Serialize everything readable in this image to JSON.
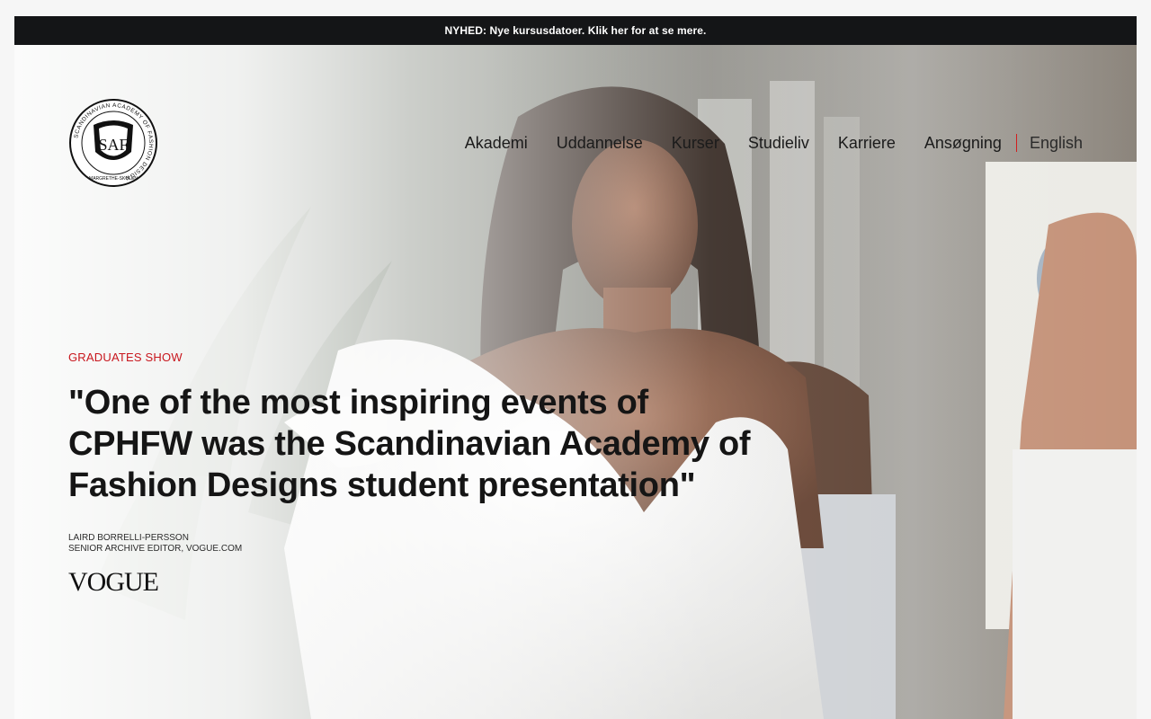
{
  "announcement": {
    "text": "NYHED: Nye kursusdatoer. Klik her for at se mere."
  },
  "logo": {
    "ring_text": "SCANDINAVIAN ACADEMY OF FASHION DESIGN",
    "bottom_text": "MARGRETHE-SKOLEN",
    "monogram": "SAF"
  },
  "nav": {
    "items": [
      {
        "label": "Akademi"
      },
      {
        "label": "Uddannelse"
      },
      {
        "label": "Kurser"
      },
      {
        "label": "Studieliv"
      },
      {
        "label": "Karriere"
      },
      {
        "label": "Ansøgning"
      }
    ],
    "language": "English"
  },
  "hero": {
    "eyebrow": "GRADUATES SHOW",
    "quote": "\"One of the most inspiring events of CPHFW was the Scandinavian Academy of Fashion Designs student presentation\"",
    "author_name": "LAIRD BORRELLI-PERSSON",
    "author_title": "SENIOR ARCHIVE EDITOR, VOGUE.COM",
    "publication": "VOGUE"
  },
  "colors": {
    "accent": "#c8161d",
    "bar_background": "#141517",
    "text": "#151515"
  }
}
